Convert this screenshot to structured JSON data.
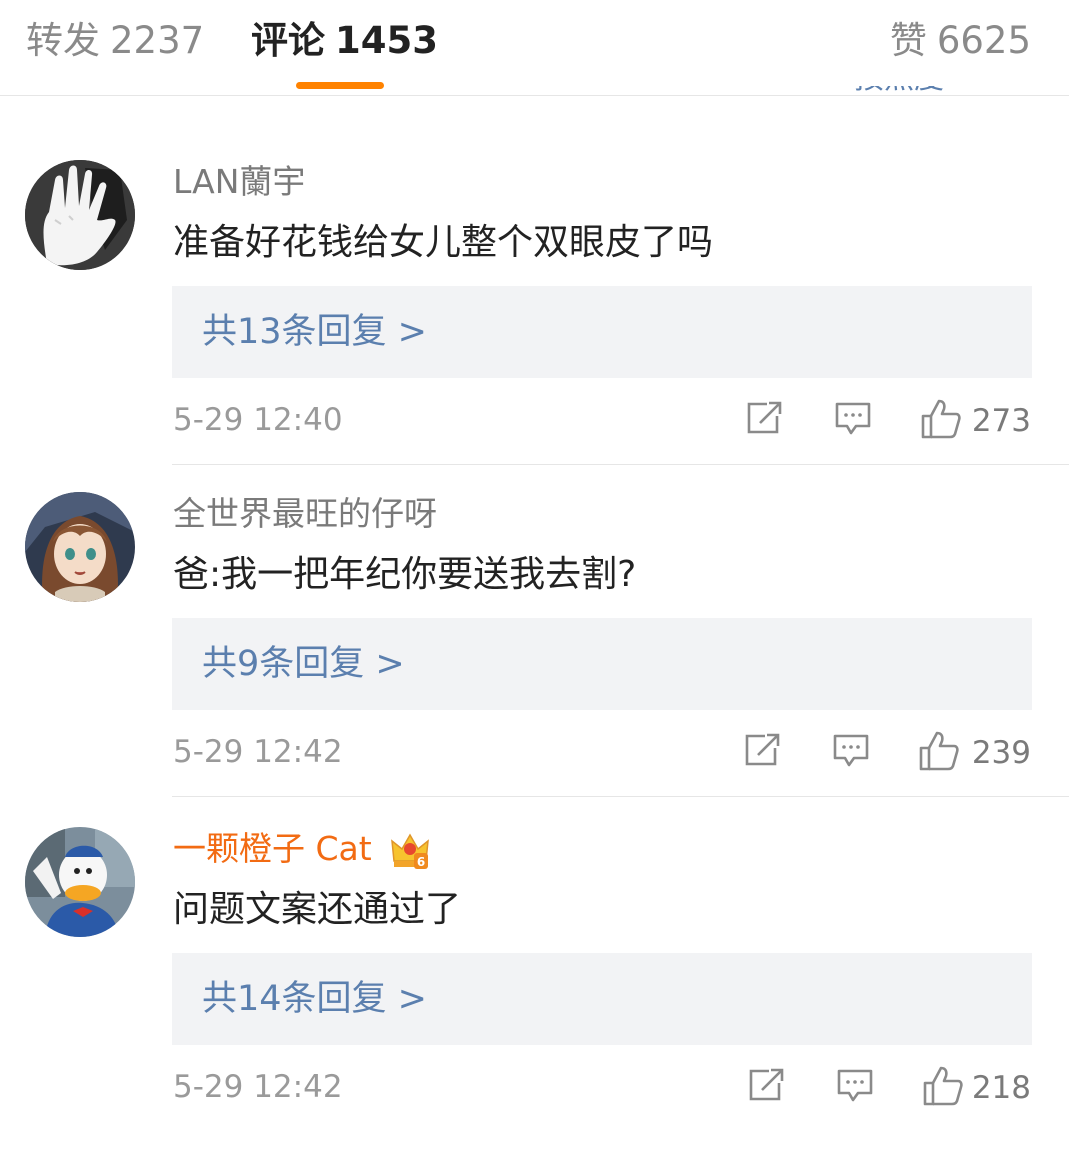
{
  "tabs": {
    "repost": {
      "label": "转发",
      "count": "2237"
    },
    "comments": {
      "label": "评论",
      "count": "1453"
    },
    "likes": {
      "label": "赞",
      "count": "6625"
    }
  },
  "sort_label": "按热度",
  "comments": [
    {
      "username": "LAN蘭宇",
      "text": "准备好花钱给女儿整个双眼皮了吗",
      "reply_link": "共13条回复 >",
      "time": "5-29 12:40",
      "likes": "273"
    },
    {
      "username": "全世界最旺的仔呀",
      "text": "爸:我一把年纪你要送我去割?",
      "reply_link": "共9条回复 >",
      "time": "5-29 12:42",
      "likes": "239"
    },
    {
      "username": "一颗橙子 Cat",
      "text": "问题文案还通过了",
      "reply_link": "共14条回复 >",
      "time": "5-29 12:42",
      "likes": "218",
      "badge": "6"
    }
  ],
  "colors": {
    "accent": "#ff8200",
    "link": "#5b7fae",
    "vip_name": "#f26b13",
    "muted": "#9a9a9a"
  }
}
